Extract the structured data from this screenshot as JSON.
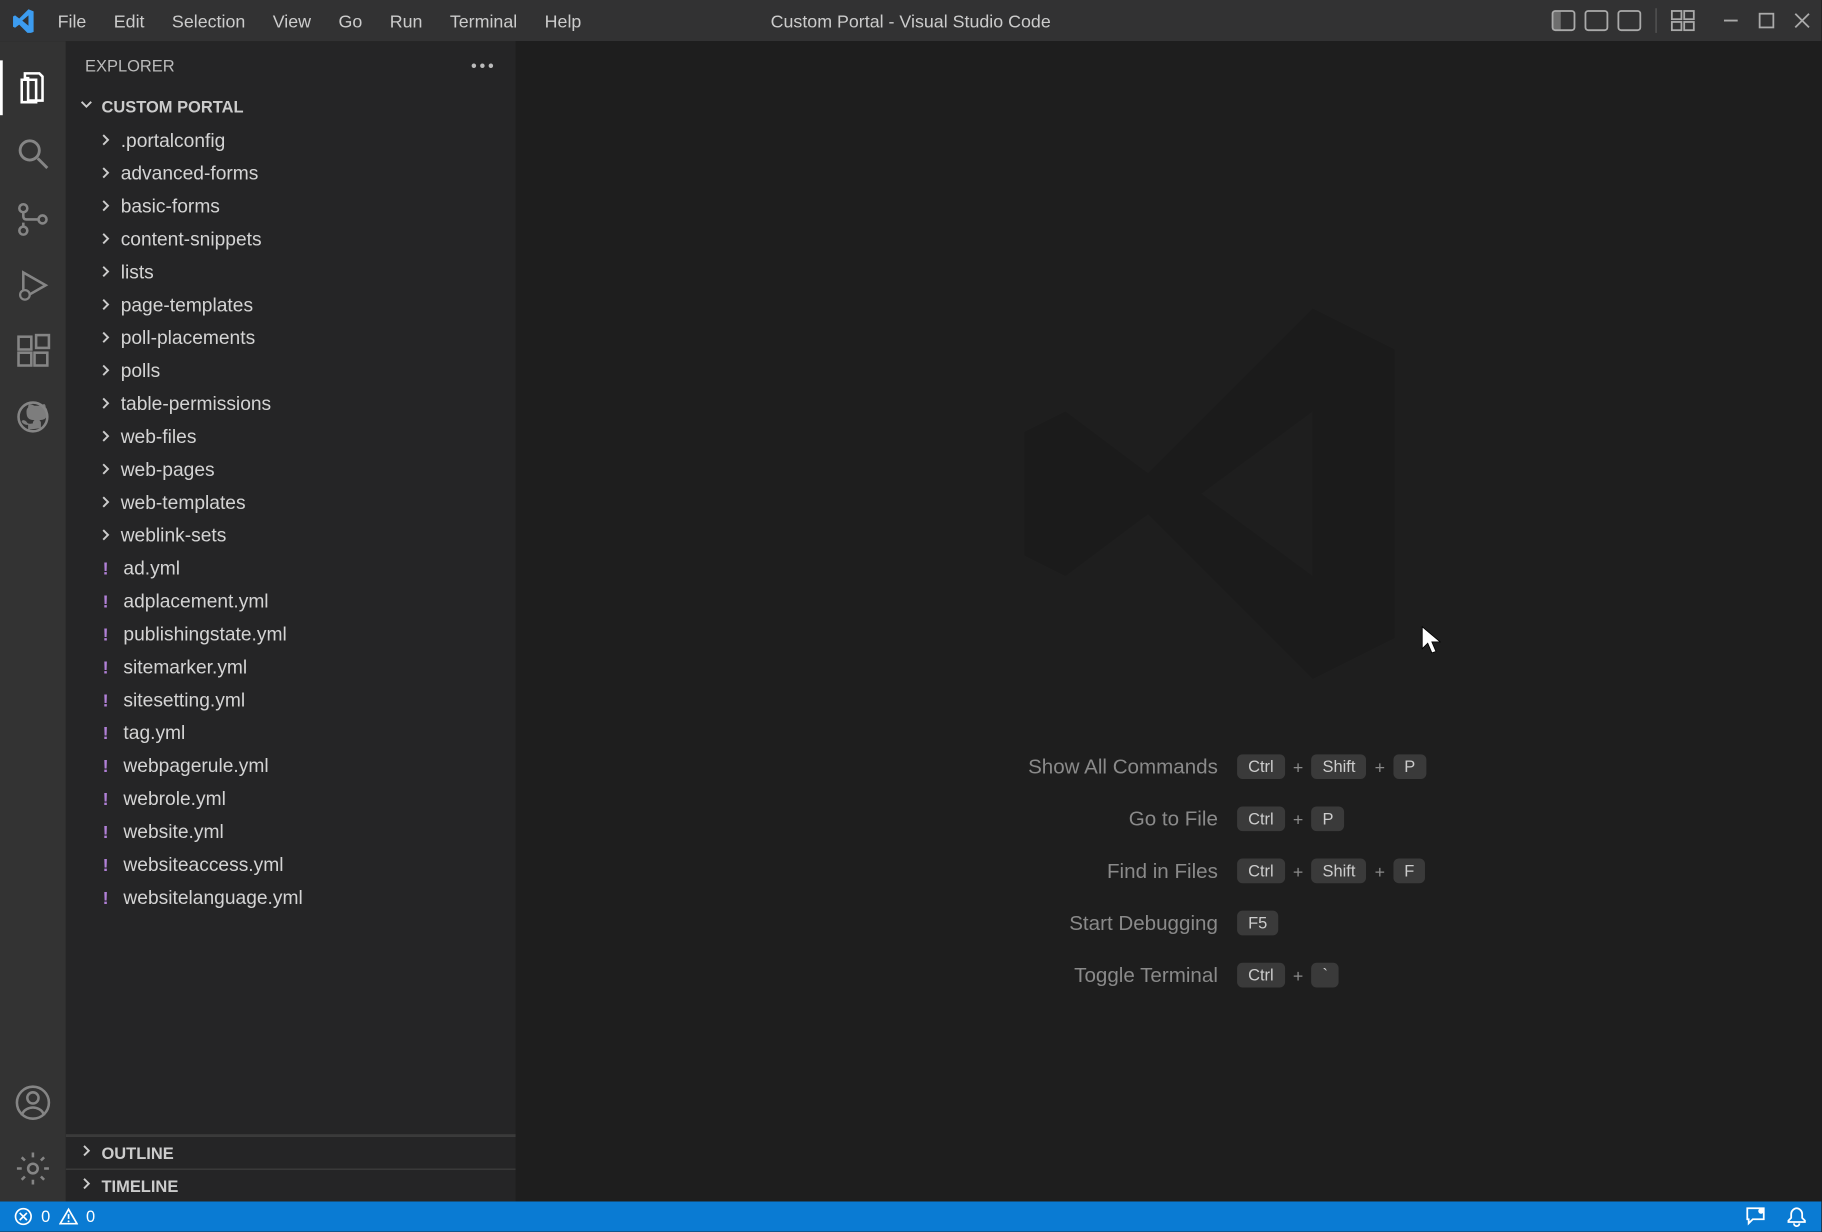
{
  "title": "Custom Portal - Visual Studio Code",
  "menu": [
    "File",
    "Edit",
    "Selection",
    "View",
    "Go",
    "Run",
    "Terminal",
    "Help"
  ],
  "sidebar": {
    "header": "EXPLORER",
    "root": "CUSTOM PORTAL",
    "folders": [
      ".portalconfig",
      "advanced-forms",
      "basic-forms",
      "content-snippets",
      "lists",
      "page-templates",
      "poll-placements",
      "polls",
      "table-permissions",
      "web-files",
      "web-pages",
      "web-templates",
      "weblink-sets"
    ],
    "files": [
      "ad.yml",
      "adplacement.yml",
      "publishingstate.yml",
      "sitemarker.yml",
      "sitesetting.yml",
      "tag.yml",
      "webpagerule.yml",
      "webrole.yml",
      "website.yml",
      "websiteaccess.yml",
      "websitelanguage.yml"
    ],
    "outline": "OUTLINE",
    "timeline": "TIMELINE"
  },
  "shortcuts": [
    {
      "label": "Show All Commands",
      "keys": [
        "Ctrl",
        "Shift",
        "P"
      ]
    },
    {
      "label": "Go to File",
      "keys": [
        "Ctrl",
        "P"
      ]
    },
    {
      "label": "Find in Files",
      "keys": [
        "Ctrl",
        "Shift",
        "F"
      ]
    },
    {
      "label": "Start Debugging",
      "keys": [
        "F5"
      ]
    },
    {
      "label": "Toggle Terminal",
      "keys": [
        "Ctrl",
        "`"
      ]
    }
  ],
  "status": {
    "errors": "0",
    "warnings": "0"
  }
}
